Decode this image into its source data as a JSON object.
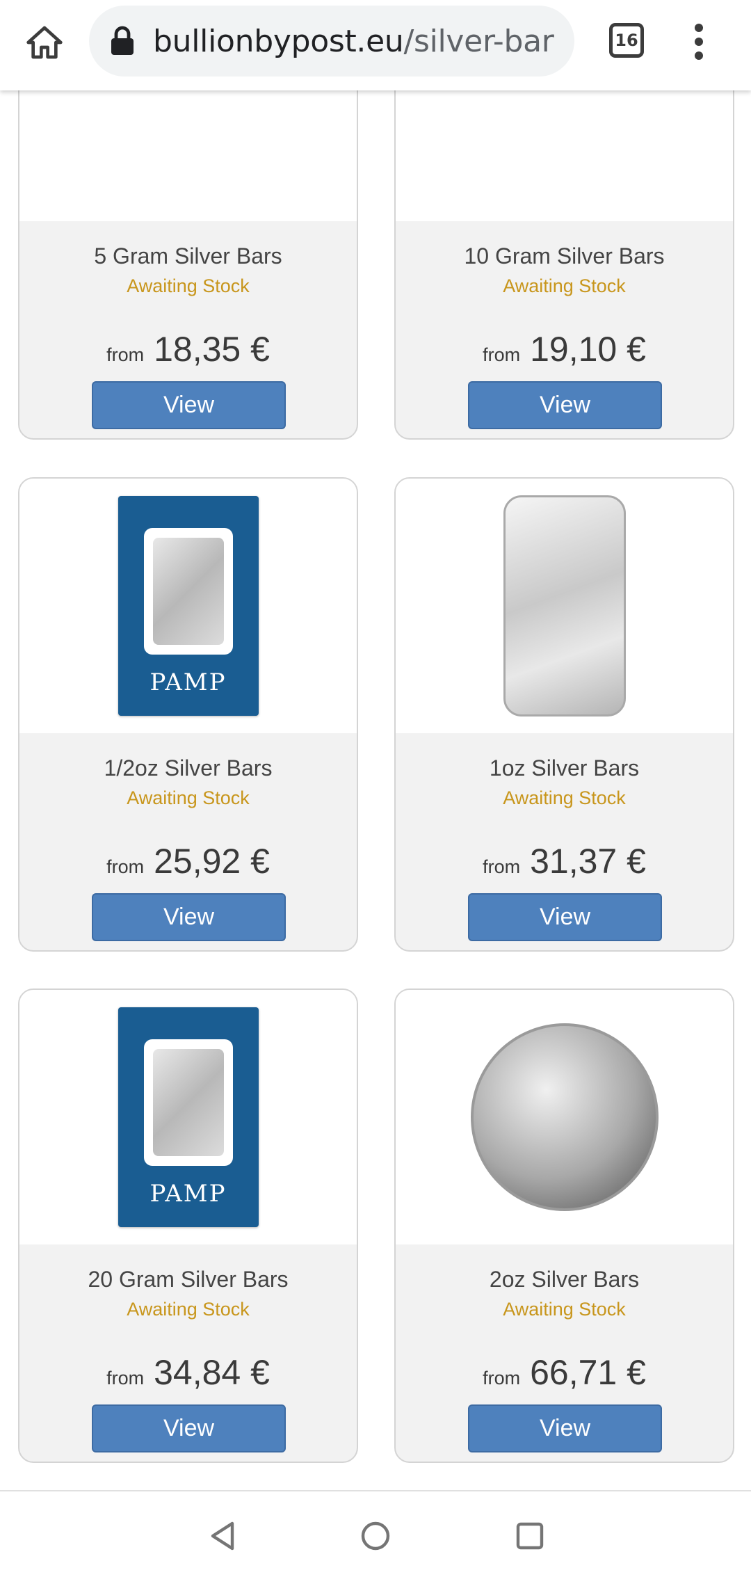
{
  "browser": {
    "url_domain": "bullionbypost.eu",
    "url_path": "/silver-bar",
    "tab_count": "16"
  },
  "icons": {
    "home": "home-icon",
    "lock": "lock-icon",
    "menu": "more-vert-icon",
    "back": "nav-back-icon",
    "home_nav": "nav-home-icon",
    "recents": "nav-recents-icon"
  },
  "colors": {
    "view_button": "#4e81bd",
    "stock_status": "#c8961c",
    "card_bg": "#f2f2f2"
  },
  "products": [
    {
      "name": "5 Gram Silver Bars",
      "status": "Awaiting Stock",
      "from_label": "from",
      "price": "18,35 €",
      "button": "View"
    },
    {
      "name": "10 Gram Silver Bars",
      "status": "Awaiting Stock",
      "from_label": "from",
      "price": "19,10 €",
      "button": "View"
    },
    {
      "name": "1/2oz Silver Bars",
      "status": "Awaiting Stock",
      "from_label": "from",
      "price": "25,92 €",
      "button": "View",
      "image_text": "PAMP"
    },
    {
      "name": "1oz Silver Bars",
      "status": "Awaiting Stock",
      "from_label": "from",
      "price": "31,37 €",
      "button": "View"
    },
    {
      "name": "20 Gram Silver Bars",
      "status": "Awaiting Stock",
      "from_label": "from",
      "price": "34,84 €",
      "button": "View",
      "image_text": "PAMP"
    },
    {
      "name": "2oz Silver Bars",
      "status": "Awaiting Stock",
      "from_label": "from",
      "price": "66,71 €",
      "button": "View"
    }
  ]
}
